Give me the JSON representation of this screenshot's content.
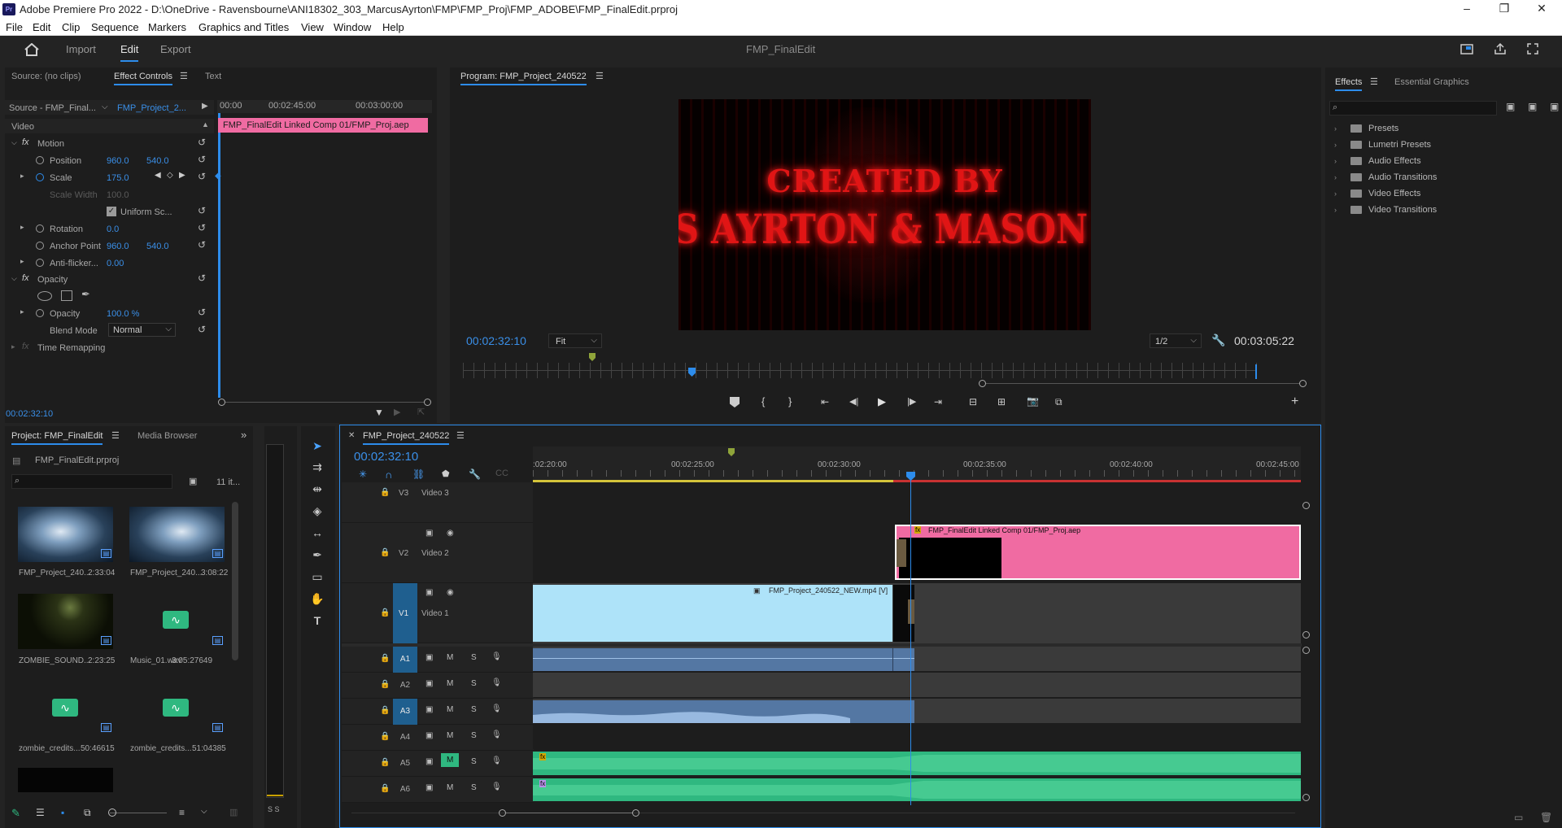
{
  "window": {
    "title": "Adobe Premiere Pro 2022 - D:\\OneDrive - Ravensbourne\\ANI18302_303_MarcusAyrton\\FMP\\FMP_Proj\\FMP_ADOBE\\FMP_FinalEdit.prproj",
    "app_icon": "Pr",
    "minimize": "–",
    "maximize": "❐",
    "close": "✕"
  },
  "menu": [
    "File",
    "Edit",
    "Clip",
    "Sequence",
    "Markers",
    "Graphics and Titles",
    "View",
    "Window",
    "Help"
  ],
  "workspace": {
    "home_icon": "home-icon",
    "tabs": [
      "Import",
      "Edit",
      "Export"
    ],
    "active": "Edit",
    "project_title": "FMP_FinalEdit"
  },
  "source_panel": {
    "tabs": [
      "Source: (no clips)",
      "Effect Controls",
      "Text"
    ],
    "active": "Effect Controls",
    "source_label": "Source - FMP_Final...",
    "sequence_label": "FMP_Project_2...",
    "ruler": [
      "00:00",
      "00:02:45:00",
      "00:03:00:00"
    ],
    "clip_label": "FMP_FinalEdit Linked Comp 01/FMP_Proj.aep",
    "section": "Video",
    "effects": {
      "motion": "Motion",
      "position": "Position",
      "position_x": "960.0",
      "position_y": "540.0",
      "scale": "Scale",
      "scale_val": "175.0",
      "scale_width": "Scale Width",
      "scale_width_val": "100.0",
      "uniform": "Uniform Sc...",
      "rotation": "Rotation",
      "rotation_val": "0.0",
      "anchor": "Anchor Point",
      "anchor_x": "960.0",
      "anchor_y": "540.0",
      "anti": "Anti-flicker...",
      "anti_val": "0.00",
      "opacity_group": "Opacity",
      "opacity": "Opacity",
      "opacity_val": "100.0 %",
      "blend": "Blend Mode",
      "blend_val": "Normal",
      "time_remap": "Time Remapping"
    },
    "timecode": "00:02:32:10"
  },
  "program": {
    "title": "Program: FMP_Project_240522",
    "line1": "CREATED BY",
    "line2": "S AYRTON & MASON H.",
    "timecode": "00:02:32:10",
    "zoom": "Fit",
    "resolution": "1/2",
    "duration": "00:03:05:22"
  },
  "effects_panel": {
    "tabs": [
      "Effects",
      "Essential Graphics"
    ],
    "active": "Effects",
    "items": [
      "Presets",
      "Lumetri Presets",
      "Audio Effects",
      "Audio Transitions",
      "Video Effects",
      "Video Transitions"
    ]
  },
  "project": {
    "tabs": [
      "Project: FMP_FinalEdit",
      "Media Browser"
    ],
    "file": "FMP_FinalEdit.prproj",
    "count": "11 it...",
    "items": [
      {
        "name": "FMP_Project_240...",
        "dur": "2:33:04"
      },
      {
        "name": "FMP_Project_240...",
        "dur": "3:08:22"
      },
      {
        "name": "ZOMBIE_SOUND...",
        "dur": "2:23:25"
      },
      {
        "name": "Music_01.wav",
        "dur": "3:05:27649"
      },
      {
        "name": "zombie_credits...",
        "dur": "50:46615"
      },
      {
        "name": "zombie_credits...",
        "dur": "51:04385"
      }
    ]
  },
  "timeline": {
    "title": "FMP_Project_240522",
    "timecode": "00:02:32:10",
    "ruler": [
      ":02:20:00",
      "00:02:25:00",
      "00:02:30:00",
      "00:02:35:00",
      "00:02:40:00",
      "00:02:45:00"
    ],
    "video_tracks": [
      {
        "id": "V3",
        "name": "Video 3"
      },
      {
        "id": "V2",
        "name": "Video 2"
      },
      {
        "id": "V1",
        "name": "Video 1"
      }
    ],
    "audio_tracks": [
      "A1",
      "A2",
      "A3",
      "A4",
      "A5",
      "A6"
    ],
    "mute": "M",
    "solo": "S",
    "solo_meter": "S S",
    "clip_v2": "FMP_FinalEdit Linked Comp 01/FMP_Proj.aep",
    "clip_v1": "FMP_Project_240522_NEW.mp4 [V]",
    "fx": "fx"
  },
  "colors": {
    "accent": "#2d8ceb",
    "pink": "#f06ba2",
    "lightblue": "#aee3f9",
    "audio_green": "#2fb880",
    "audio_blue": "#5477a3",
    "title_red": "#e01515"
  }
}
